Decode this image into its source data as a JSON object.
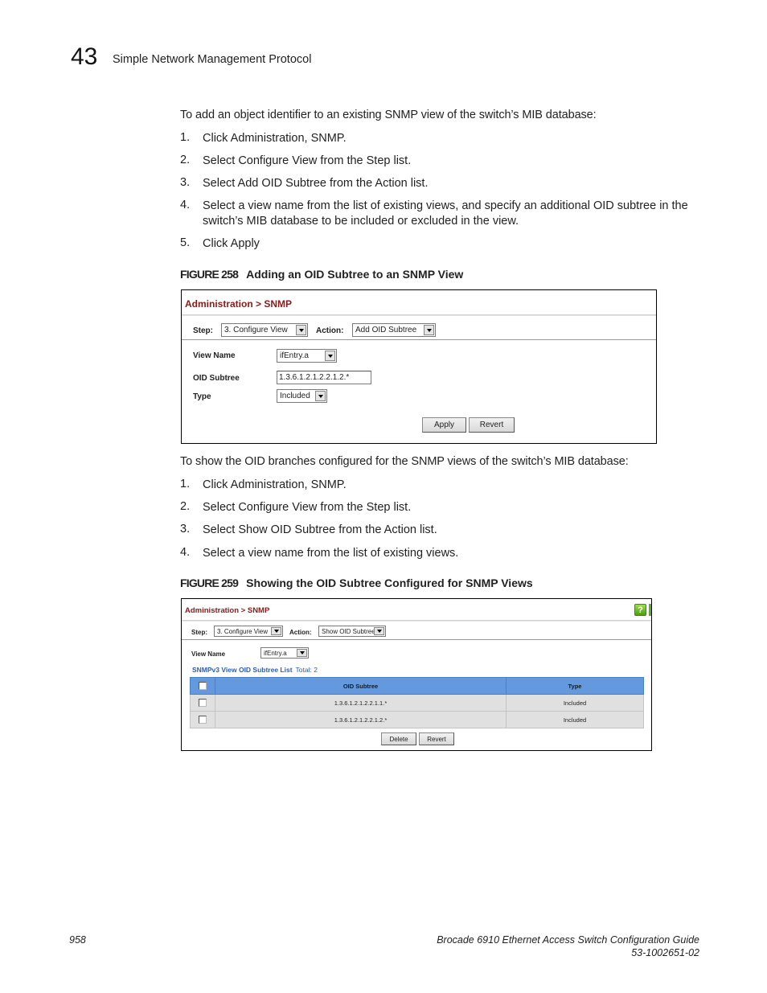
{
  "header": {
    "chapter_number": "43",
    "chapter_title": "Simple Network Management Protocol"
  },
  "section1": {
    "intro": "To add an object identifier to an existing SNMP view of the switch’s MIB database:",
    "steps": [
      {
        "num": "1.",
        "text": "Click Administration, SNMP."
      },
      {
        "num": "2.",
        "text": "Select Configure View from the Step list."
      },
      {
        "num": "3.",
        "text": "Select Add OID Subtree from the Action list."
      },
      {
        "num": "4.",
        "text": "Select a view name from the list of existing views, and specify an additional OID subtree in the switch’s MIB database to be included or excluded in the view."
      },
      {
        "num": "5.",
        "text": "Click Apply"
      }
    ]
  },
  "figure258": {
    "label": "FIGURE 258",
    "caption": "Adding an OID Subtree to an SNMP View",
    "breadcrumb": "Administration > SNMP",
    "step_label": "Step:",
    "step_value": "3. Configure View",
    "action_label": "Action:",
    "action_value": "Add OID Subtree",
    "view_name_label": "View Name",
    "view_name_value": "ifEntry.a",
    "oid_subtree_label": "OID Subtree",
    "oid_subtree_value": "1.3.6.1.2.1.2.2.1.2.*",
    "type_label": "Type",
    "type_value": "Included",
    "apply_label": "Apply",
    "revert_label": "Revert"
  },
  "section2": {
    "intro": "To show the OID branches configured for the SNMP views of the switch’s MIB database:",
    "steps": [
      {
        "num": "1.",
        "text": "Click Administration, SNMP."
      },
      {
        "num": "2.",
        "text": "Select Configure View from the Step list."
      },
      {
        "num": "3.",
        "text": "Select Show OID Subtree from the Action list."
      },
      {
        "num": "4.",
        "text": "Select a view name from the list of existing views."
      }
    ]
  },
  "figure259": {
    "label": "FIGURE 259",
    "caption": "Showing the OID Subtree Configured for SNMP Views",
    "breadcrumb": "Administration > SNMP",
    "help_icon": "?",
    "step_label": "Step:",
    "step_value": "3. Configure View",
    "action_label": "Action:",
    "action_value": "Show OID Subtree",
    "view_name_label": "View Name",
    "view_name_value": "ifEntry.a",
    "list_title": "SNMPv3 View OID Subtree List",
    "list_total": "Total: 2",
    "columns": [
      "OID Subtree",
      "Type"
    ],
    "rows": [
      {
        "oid": "1.3.6.1.2.1.2.2.1.1.*",
        "type": "Included"
      },
      {
        "oid": "1.3.6.1.2.1.2.2.1.2.*",
        "type": "Included"
      }
    ],
    "delete_label": "Delete",
    "revert_label": "Revert"
  },
  "footer": {
    "page_number": "958",
    "doc_title": "Brocade 6910 Ethernet Access Switch Configuration Guide",
    "doc_number": "53-1002651-02"
  }
}
